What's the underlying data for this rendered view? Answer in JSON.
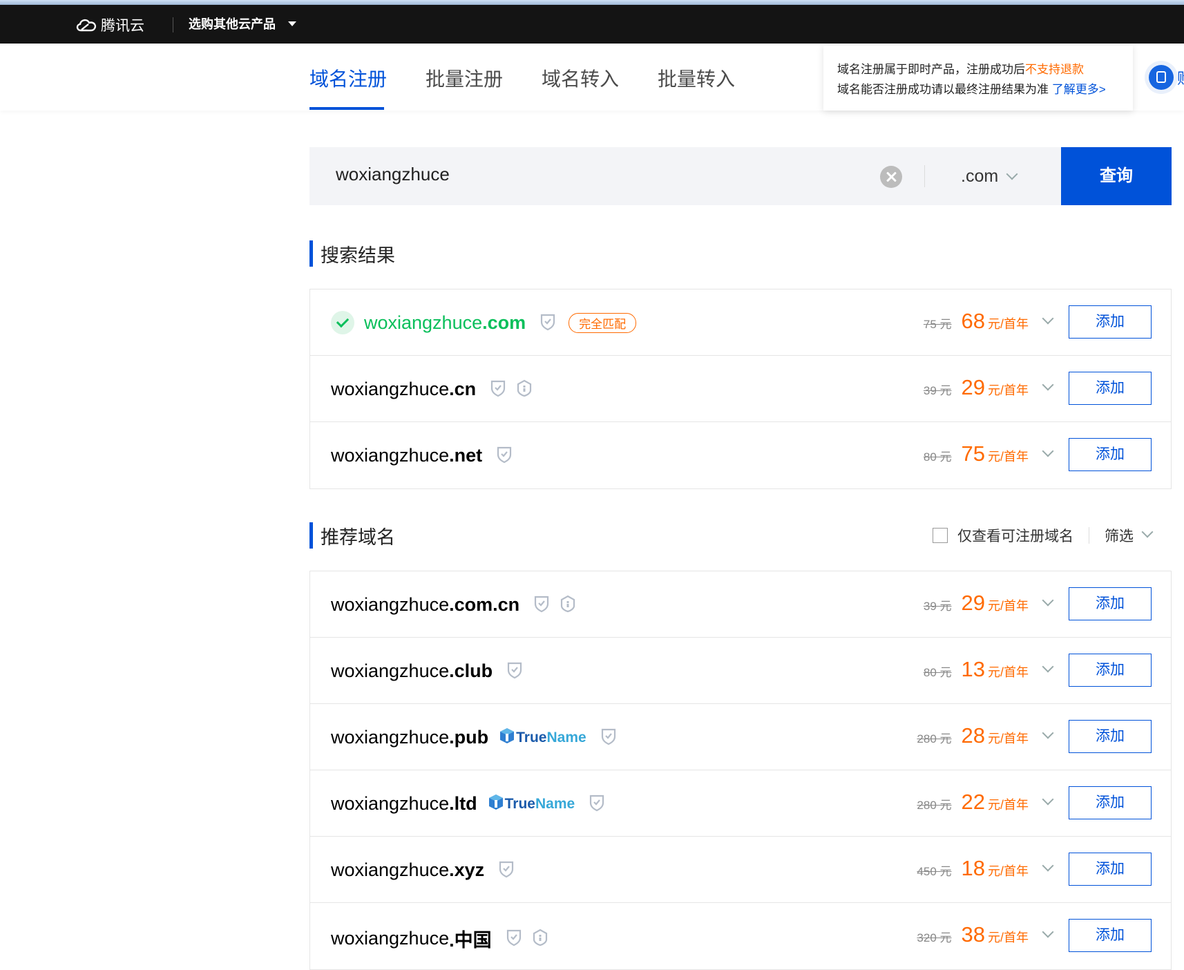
{
  "header": {
    "brand": "腾讯云",
    "products_menu": "选购其他云产品"
  },
  "tabs": [
    {
      "label": "域名注册",
      "active": true
    },
    {
      "label": "批量注册",
      "active": false
    },
    {
      "label": "域名转入",
      "active": false
    },
    {
      "label": "批量转入",
      "active": false
    }
  ],
  "notice": {
    "line1_prefix": "域名注册属于即时产品，注册成功后",
    "line1_highlight": "不支持退款",
    "line2_prefix": "域名能否注册成功请以最终注册结果为准",
    "line2_link": "了解更多>"
  },
  "side_button_text": "购",
  "search": {
    "value": "woxiangzhuce",
    "suffix": ".com",
    "button": "查询"
  },
  "results_title": "搜索结果",
  "results": [
    {
      "base": "woxiangzhuce",
      "tld": ".com",
      "available": true,
      "badge": "完全匹配",
      "shield": true,
      "trust": false,
      "truename": false,
      "old_price": "75 元",
      "price": "68",
      "unit": "元/首年",
      "action": "添加"
    },
    {
      "base": "woxiangzhuce",
      "tld": ".cn",
      "available": false,
      "badge": "",
      "shield": true,
      "trust": true,
      "truename": false,
      "old_price": "39 元",
      "price": "29",
      "unit": "元/首年",
      "action": "添加"
    },
    {
      "base": "woxiangzhuce",
      "tld": ".net",
      "available": false,
      "badge": "",
      "shield": true,
      "trust": false,
      "truename": false,
      "old_price": "80 元",
      "price": "75",
      "unit": "元/首年",
      "action": "添加"
    }
  ],
  "recommend_title": "推荐域名",
  "filter": {
    "checkbox_label": "仅查看可注册域名",
    "checked": false,
    "filter_label": "筛选"
  },
  "truename_text": {
    "part1": "True",
    "part2": "Name"
  },
  "recommendations": [
    {
      "base": "woxiangzhuce",
      "tld": ".com.cn",
      "shield": true,
      "trust": true,
      "truename": false,
      "old_price": "39 元",
      "price": "29",
      "unit": "元/首年",
      "action": "添加"
    },
    {
      "base": "woxiangzhuce",
      "tld": ".club",
      "shield": true,
      "trust": false,
      "truename": false,
      "old_price": "80 元",
      "price": "13",
      "unit": "元/首年",
      "action": "添加"
    },
    {
      "base": "woxiangzhuce",
      "tld": ".pub",
      "shield": true,
      "trust": false,
      "truename": true,
      "old_price": "280 元",
      "price": "28",
      "unit": "元/首年",
      "action": "添加"
    },
    {
      "base": "woxiangzhuce",
      "tld": ".ltd",
      "shield": true,
      "trust": false,
      "truename": true,
      "old_price": "280 元",
      "price": "22",
      "unit": "元/首年",
      "action": "添加"
    },
    {
      "base": "woxiangzhuce",
      "tld": ".xyz",
      "shield": true,
      "trust": false,
      "truename": false,
      "old_price": "450 元",
      "price": "18",
      "unit": "元/首年",
      "action": "添加"
    },
    {
      "base": "woxiangzhuce",
      "tld": ".中国",
      "shield": true,
      "trust": true,
      "truename": false,
      "old_price": "320 元",
      "price": "38",
      "unit": "元/首年",
      "action": "添加"
    }
  ],
  "colors": {
    "accent": "#0052d9",
    "price": "#ff6a00",
    "available": "#0abf5b"
  }
}
